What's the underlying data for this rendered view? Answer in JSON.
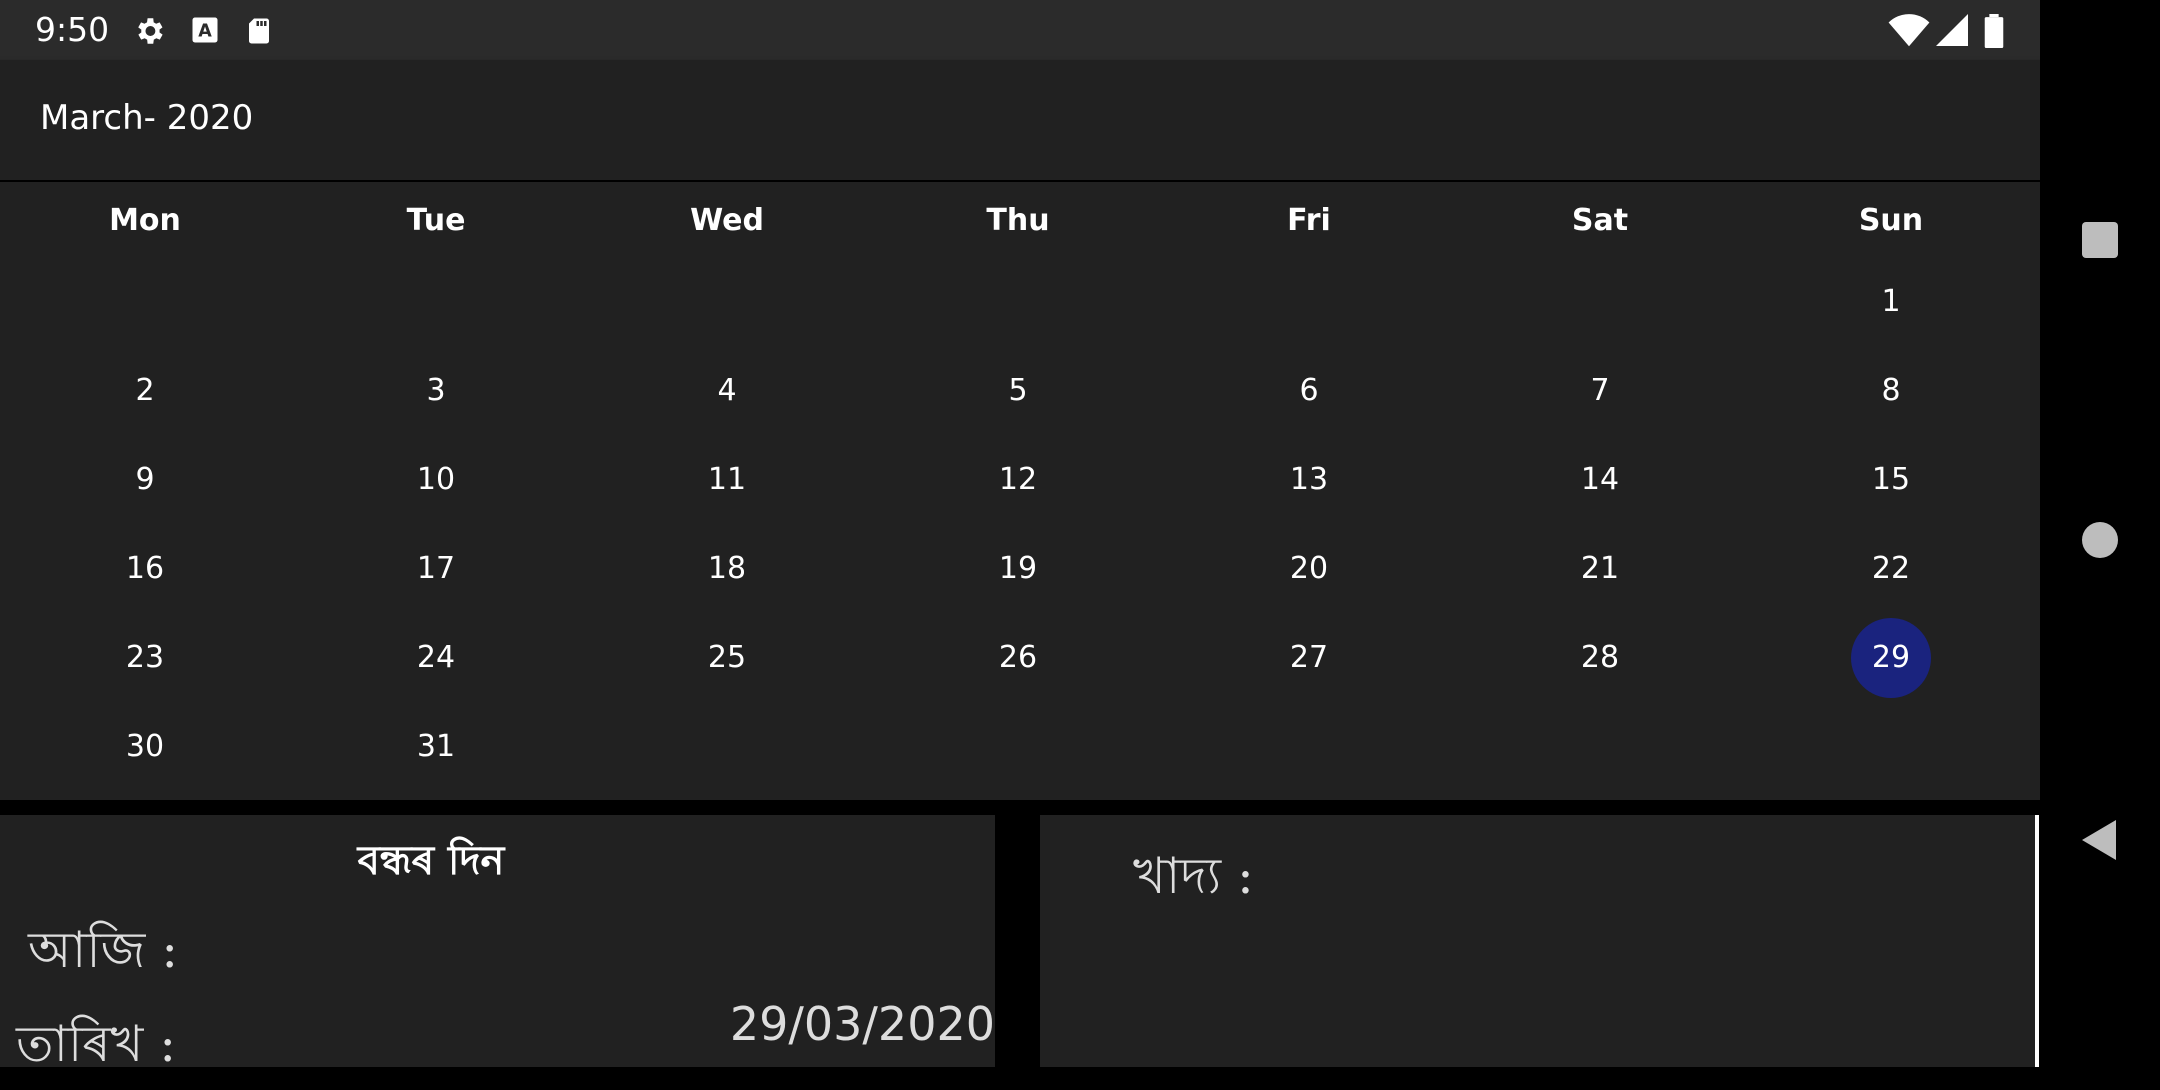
{
  "status_bar": {
    "time": "9:50",
    "icons": [
      "settings-gear-icon",
      "keyboard-a-icon",
      "sd-card-icon",
      "wifi-icon",
      "cell-signal-icon",
      "battery-icon"
    ]
  },
  "toolbar": {
    "title": "March- 2020"
  },
  "calendar": {
    "weekdays": [
      "Mon",
      "Tue",
      "Wed",
      "Thu",
      "Fri",
      "Sat",
      "Sun"
    ],
    "weeks": [
      [
        "",
        "",
        "",
        "",
        "",
        "",
        "1"
      ],
      [
        "2",
        "3",
        "4",
        "5",
        "6",
        "7",
        "8"
      ],
      [
        "9",
        "10",
        "11",
        "12",
        "13",
        "14",
        "15"
      ],
      [
        "16",
        "17",
        "18",
        "19",
        "20",
        "21",
        "22"
      ],
      [
        "23",
        "24",
        "25",
        "26",
        "27",
        "28",
        "29"
      ],
      [
        "30",
        "31",
        "",
        "",
        "",
        "",
        ""
      ]
    ],
    "selected_day": "29",
    "selected_color": "#1a237e"
  },
  "holiday_panel": {
    "title": "বন্ধৰ দিন",
    "today_label": "আজি :",
    "date_label": "তাৰিখ :",
    "date_value": "29/03/2020"
  },
  "food_panel": {
    "label": "খাদ্য :"
  },
  "nav": {
    "icons": [
      "recent-apps-icon",
      "home-icon",
      "back-icon"
    ]
  }
}
